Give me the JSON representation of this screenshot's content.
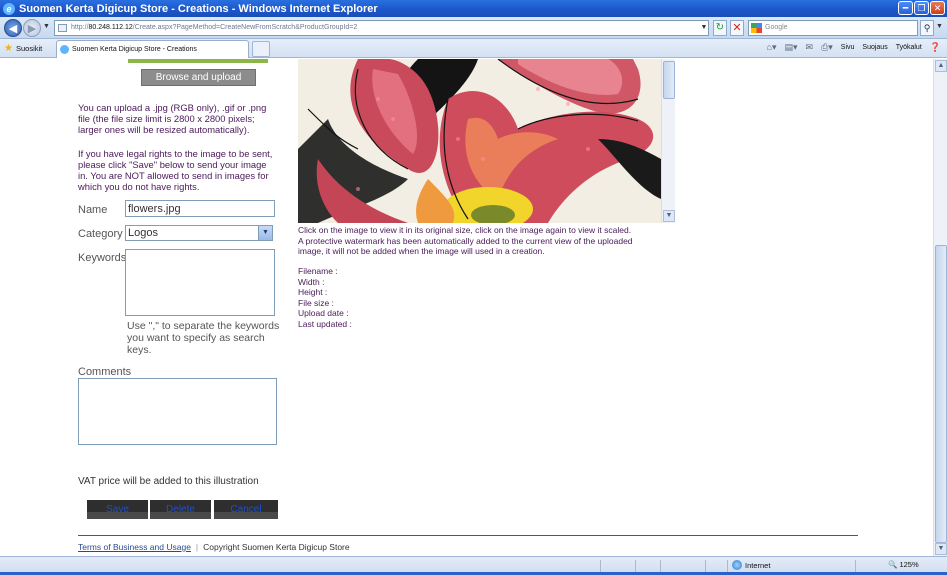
{
  "window": {
    "title": "Suomen Kerta Digicup Store - Creations - Windows Internet Explorer",
    "minimize": "0",
    "maximize": "1",
    "close": "r"
  },
  "address": {
    "url_prefix": "http://",
    "url_host": "80.248.112.12",
    "url_path": "/Create.aspx?PageMethod=CreateNewFromScratch&ProductGroupId=2",
    "search_placeholder": "Google"
  },
  "favorites": {
    "label": "Suosikit",
    "tab_title": "Suomen Kerta Digicup Store - Creations"
  },
  "commandbar": {
    "page": "Sivu",
    "safety": "Suojaus",
    "tools": "Työkalut"
  },
  "form": {
    "browse_label": "Browse and upload",
    "upload_info": "You can upload a .jpg (RGB only), .gif or .png file (the file size limit is 2800 x 2800 pixels; larger ones will be resized automatically).",
    "rights_info": "If you have legal rights to the image to be sent, please click \"Save\" below to send your image in. You are NOT allowed to send in images for which you do not have rights.",
    "name_label": "Name",
    "name_value": "flowers.jpg",
    "category_label": "Category",
    "category_value": "Logos",
    "keywords_label": "Keywords",
    "keywords_hint": "Use \",\" to separate the keywords you want to specify as search keys.",
    "comments_label": "Comments",
    "vat_note": "VAT price will be added to this illustration",
    "save_label": "Save",
    "delete_label": "Delete",
    "cancel_label": "Cancel"
  },
  "preview": {
    "caption1": "Click on the image to view it in its original size, click on the image again to view it scaled.",
    "caption2": "A protective watermark has been automatically added to the current view of the uploaded image, it will not be added when the image will used in a creation.",
    "filename_label": "Filename :",
    "width_label": "Width :",
    "height_label": "Height :",
    "filesize_label": "File size :",
    "uploaddate_label": "Upload date :",
    "lastupdated_label": "Last updated :"
  },
  "footer": {
    "terms_label": "Terms of Business and Usage",
    "copyright": "Copyright Suomen Kerta Digicup Store"
  },
  "status": {
    "zone": "Internet",
    "zoom": "125%"
  }
}
